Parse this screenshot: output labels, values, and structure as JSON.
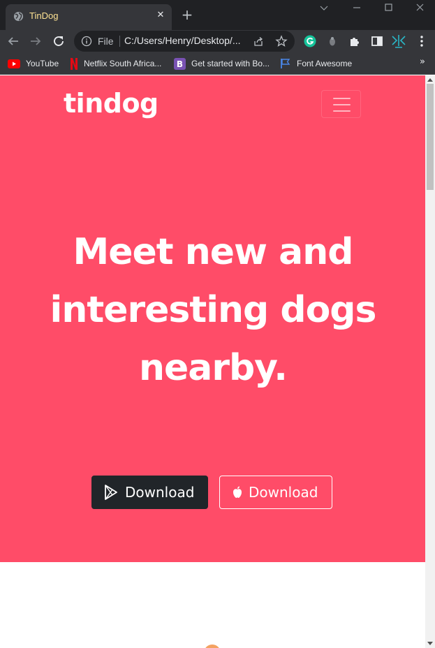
{
  "browser": {
    "tab": {
      "title": "TinDog",
      "close_icon": "close-icon"
    },
    "new_tab_icon": "plus-icon",
    "window_controls": [
      "chevron-down-icon",
      "minimize-icon",
      "maximize-icon",
      "close-icon"
    ],
    "omnibox": {
      "scheme_label": "File",
      "url": "C:/Users/Henry/Desktop/..."
    },
    "bookmarks": [
      {
        "label": "YouTube",
        "icon": "youtube-icon"
      },
      {
        "label": "Netflix South Africa...",
        "icon": "netflix-icon"
      },
      {
        "label": "Get started with Bo...",
        "icon": "bootstrap-icon"
      },
      {
        "label": "Font Awesome",
        "icon": "flag-icon"
      }
    ]
  },
  "page": {
    "brand": "tindog",
    "headline": "Meet new and interesting dogs nearby.",
    "buttons": [
      {
        "label": "Download",
        "icon": "google-play-icon",
        "style": "dark"
      },
      {
        "label": "Download",
        "icon": "apple-icon",
        "style": "outline"
      }
    ]
  },
  "colors": {
    "hero_background": "#ff4c68",
    "dark_button": "#212529",
    "browser_frame": "#202124",
    "browser_toolbar": "#35363a",
    "tab_title": "#fde293"
  }
}
